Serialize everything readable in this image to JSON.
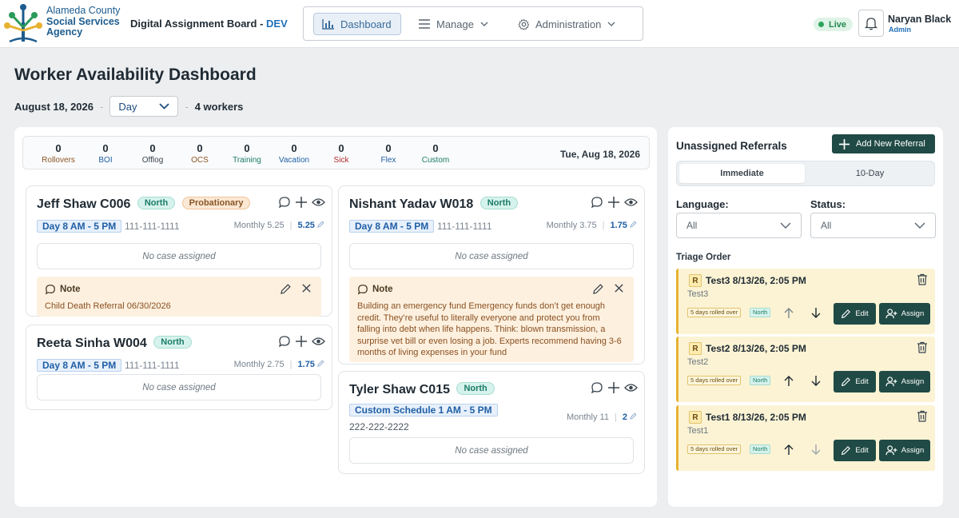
{
  "header": {
    "org_line1": "Alameda County",
    "org_line2": "Social Services",
    "org_line3": "Agency",
    "app_title": "Digital Assignment Board",
    "env_sep": "-",
    "env": "DEV",
    "nav": {
      "dashboard": "Dashboard",
      "manage": "Manage",
      "administration": "Administration"
    },
    "live_label": "Live",
    "user_name": "Naryan Black",
    "user_role": "Admin"
  },
  "page": {
    "title": "Worker Availability Dashboard",
    "date": "August 18, 2026",
    "view": "Day",
    "worker_count": "4 workers"
  },
  "stats": [
    {
      "value": "0",
      "label": "Rollovers",
      "color": "#8a5524"
    },
    {
      "value": "0",
      "label": "BOI",
      "color": "#1f5fa6"
    },
    {
      "value": "0",
      "label": "Offlog",
      "color": "#3a444d"
    },
    {
      "value": "0",
      "label": "OCS",
      "color": "#8a5524"
    },
    {
      "value": "0",
      "label": "Training",
      "color": "#1b7c67"
    },
    {
      "value": "0",
      "label": "Vacation",
      "color": "#1f5fa6"
    },
    {
      "value": "0",
      "label": "Sick",
      "color": "#b02a2a"
    },
    {
      "value": "0",
      "label": "Flex",
      "color": "#1f5fa6"
    },
    {
      "value": "0",
      "label": "Custom",
      "color": "#1b7c67"
    }
  ],
  "stats_date": "Tue, Aug 18, 2026",
  "workers": [
    {
      "name": "Jeff Shaw C006",
      "region": "North",
      "status": "Probationary",
      "shift": "Day 8 AM - 5 PM",
      "phone": "111-111-1111",
      "monthly_label": "Monthly 5.25",
      "monthly_sep": "|",
      "monthly_value": "5.25",
      "no_case": "No case assigned",
      "note_label": "Note",
      "note_text": "Child Death Referral 06/30/2026"
    },
    {
      "name": "Reeta Sinha W004",
      "region": "North",
      "shift": "Day 8 AM - 5 PM",
      "phone": "111-111-1111",
      "monthly_label": "Monthly 2.75",
      "monthly_sep": "|",
      "monthly_value": "1.75",
      "no_case": "No case assigned"
    },
    {
      "name": "Nishant Yadav W018",
      "region": "North",
      "shift": "Day 8 AM - 5 PM",
      "phone": "111-111-1111",
      "monthly_label": "Monthly 3.75",
      "monthly_sep": "|",
      "monthly_value": "1.75",
      "no_case": "No case assigned",
      "note_label": "Note",
      "note_text": "Building an emergency fund Emergency funds don’t get enough credit. They’re useful to literally everyone and protect you from falling into debt when life happens. Think: blown transmission, a surprise vet bill or even losing a job. Experts recommend having 3-6 months of living expenses in your fund"
    },
    {
      "name": "Tyler Shaw C015",
      "region": "North",
      "shift": "Custom Schedule 1 AM - 5 PM",
      "phone": "222-222-2222",
      "monthly_label": "Monthly 11",
      "monthly_sep": "|",
      "monthly_value": "2",
      "no_case": "No case assigned"
    }
  ],
  "side": {
    "title": "Unassigned Referrals",
    "add_label": "Add New Referral",
    "tab_immediate": "Immediate",
    "tab_10day": "10-Day",
    "language_label": "Language:",
    "language_value": "All",
    "status_label": "Status:",
    "status_value": "All",
    "triage_label": "Triage Order",
    "referrals": [
      {
        "badge": "R",
        "title": "Test3 8/13/26, 2:05 PM",
        "sub": "Test3",
        "rolled": "5 days rolled over",
        "region": "North",
        "edit": "Edit",
        "assign": "Assign"
      },
      {
        "badge": "R",
        "title": "Test2 8/13/26, 2:05 PM",
        "sub": "Test2",
        "rolled": "5 days rolled over",
        "region": "North",
        "edit": "Edit",
        "assign": "Assign"
      },
      {
        "badge": "R",
        "title": "Test1 8/13/26, 2:05 PM",
        "sub": "Test1",
        "rolled": "5 days rolled over",
        "region": "North",
        "edit": "Edit",
        "assign": "Assign"
      }
    ]
  },
  "colors": {
    "accent": "#204a45",
    "brand": "#1c5c8f",
    "north_bg": "#d6f2ec",
    "note_bg": "#fdf0df",
    "referral_bg": "#fbf3d4"
  },
  "icons": [
    "logo-tree-icon",
    "bar-chart-icon",
    "menu-icon",
    "gear-icon",
    "chevron-down-icon",
    "bell-icon",
    "comment-icon",
    "plus-icon",
    "eye-icon",
    "pencil-icon",
    "close-icon",
    "trash-icon",
    "arrow-up-icon",
    "arrow-down-icon",
    "user-plus-icon"
  ]
}
